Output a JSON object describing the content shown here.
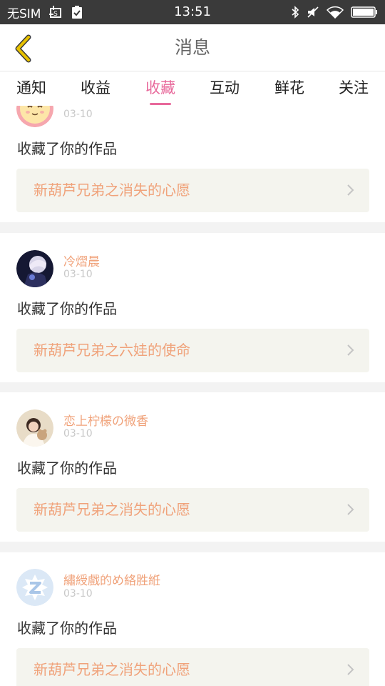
{
  "status_bar": {
    "carrier": "无SIM",
    "time": "13:51",
    "icons": [
      "screenshot-icon",
      "checklist-icon",
      "bluetooth-icon",
      "mute-icon",
      "wifi-icon",
      "battery-icon"
    ]
  },
  "header": {
    "title": "消息",
    "back_icon": "chevron-left-icon",
    "accent_color": "#e8c200"
  },
  "tabs": [
    {
      "label": "通知",
      "active": false
    },
    {
      "label": "收益",
      "active": false
    },
    {
      "label": "收藏",
      "active": true
    },
    {
      "label": "互动",
      "active": false
    },
    {
      "label": "鲜花",
      "active": false
    },
    {
      "label": "关注",
      "active": false
    }
  ],
  "colors": {
    "active_tab": "#e8699b",
    "user_name": "#f0a27a",
    "work_title": "#f0a27a",
    "date": "#c8c8c8"
  },
  "messages": [
    {
      "user": "",
      "date": "03-10",
      "action": "收藏了你的作品",
      "work": "新葫芦兄弟之消失的心愿",
      "avatar": "cartoon-face-avatar"
    },
    {
      "user": "冷熠晨",
      "date": "03-10",
      "action": "收藏了你的作品",
      "work": "新葫芦兄弟之六娃的使命",
      "avatar": "anime-character-avatar"
    },
    {
      "user": "恋上柠檬の微香",
      "date": "03-10",
      "action": "收藏了你的作品",
      "work": "新葫芦兄弟之消失的心愿",
      "avatar": "girl-photo-avatar"
    },
    {
      "user": "繡綬戲的め絡胜絍",
      "date": "03-10",
      "action": "收藏了你的作品",
      "work": "新葫芦兄弟之消失的心愿",
      "avatar": "default-app-avatar"
    }
  ]
}
